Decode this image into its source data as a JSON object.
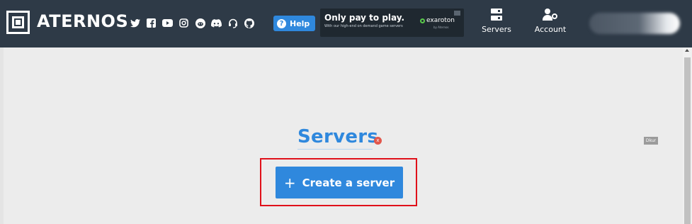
{
  "header": {
    "brand": "ATERNOS",
    "social_icons": [
      "twitter-icon",
      "facebook-icon",
      "youtube-icon",
      "instagram-icon",
      "reddit-icon",
      "discord-icon",
      "support-icon",
      "github-icon"
    ],
    "help_label": "Help",
    "ad": {
      "title": "Only pay to play.",
      "subtitle": "With our high-end on demand game servers",
      "brand": "exaroton",
      "brand_sub": "by Aternos"
    },
    "nav": {
      "servers_label": "Servers",
      "account_label": "Account"
    }
  },
  "main": {
    "title": "Servers",
    "close_badge": "x",
    "dim_tag": "Dkur",
    "create_button_label": "Create a server"
  },
  "colors": {
    "header_bg": "#2e3a47",
    "accent": "#2f88dd",
    "highlight": "#e0111a",
    "page_bg": "#ececec"
  }
}
